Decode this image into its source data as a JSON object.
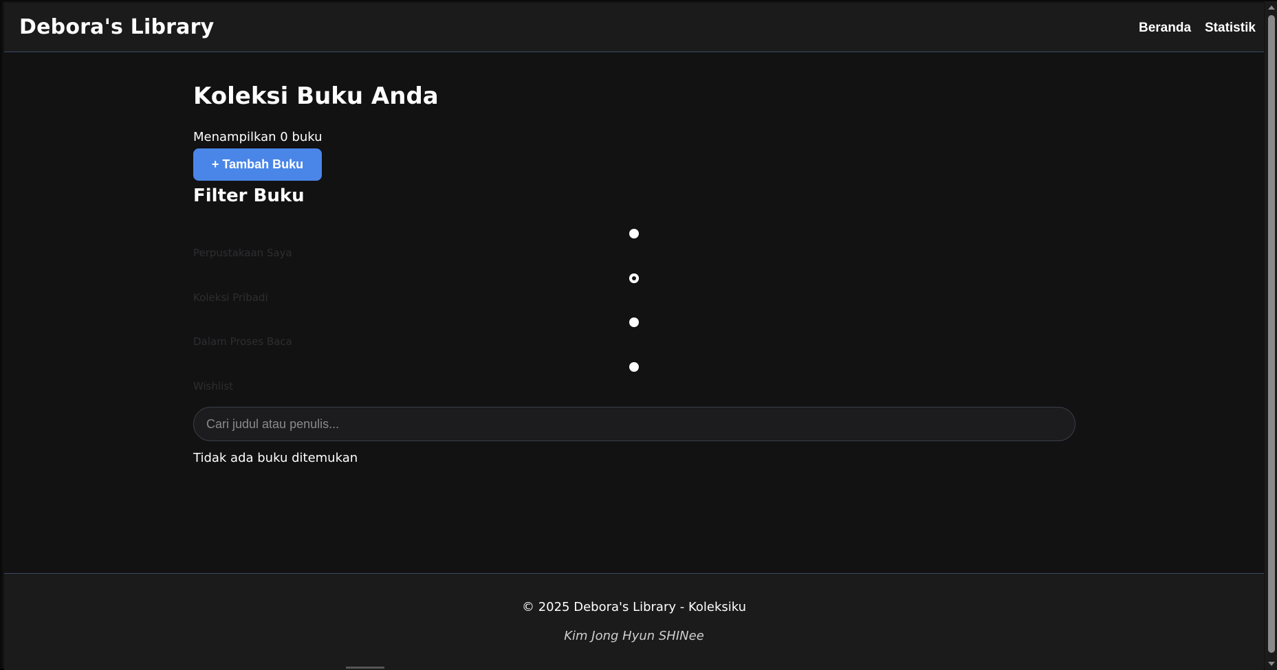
{
  "header": {
    "brand": "Debora's Library",
    "nav": {
      "home": "Beranda",
      "stats": "Statistik"
    }
  },
  "main": {
    "title": "Koleksi Buku Anda",
    "count_text": "Menampilkan 0 buku",
    "add_button": "+ Tambah Buku",
    "filter_title": "Filter Buku",
    "filters": [
      {
        "label": "Perpustakaan Saya",
        "selected": false
      },
      {
        "label": "Koleksi Pribadi",
        "selected": true
      },
      {
        "label": "Dalam Proses Baca",
        "selected": false
      },
      {
        "label": "Wishlist",
        "selected": false
      }
    ],
    "search": {
      "placeholder": "Cari judul atau penulis...",
      "value": ""
    },
    "empty_text": "Tidak ada buku ditemukan"
  },
  "footer": {
    "copyright": "© 2025 Debora's Library - Koleksiku",
    "subtitle": "Kim Jong Hyun SHINee"
  },
  "colors": {
    "background": "#121213",
    "header_bg": "#1b1b1c",
    "accent": "#4a86e8",
    "border": "#3a4a66"
  }
}
